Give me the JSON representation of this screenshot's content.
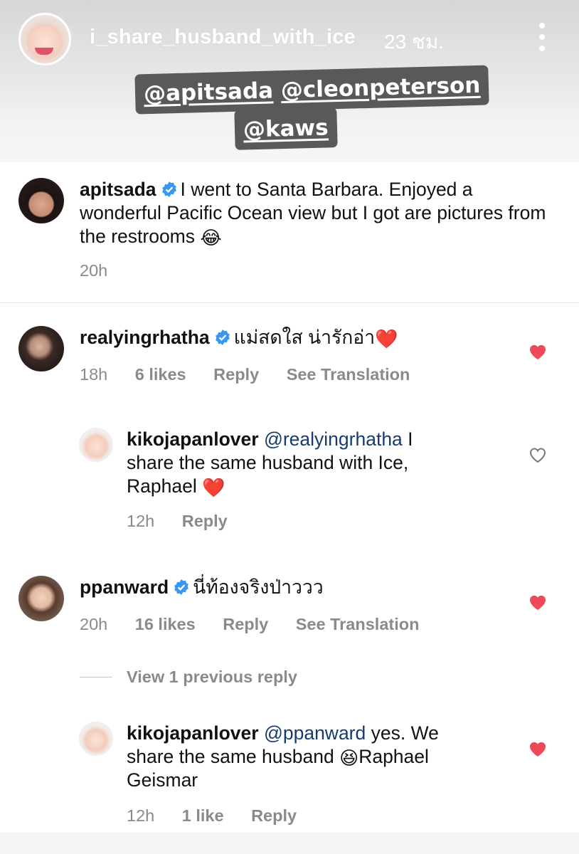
{
  "story": {
    "username": "i_share_husband_with_ice",
    "time": "23 ชม.",
    "tags": [
      "@apitsada",
      "@cleonpeterson",
      "@kaws"
    ]
  },
  "comments": [
    {
      "username": "apitsada",
      "text": "I went to Santa Barbara. Enjoyed a wonderful Pacific Ocean view but I got are pictures from the restrooms",
      "emoji": "😂",
      "time": "20h"
    },
    {
      "username": "realyingrhatha",
      "text": "แม่สดใส น่ารักอ่า",
      "emoji": "❤️",
      "time": "18h",
      "likes": "6 likes",
      "reply": "Reply",
      "translate": "See Translation",
      "liked": true,
      "replies": [
        {
          "username": "kikojapanlover",
          "mention": "@realyingrhatha",
          "text_1": "I",
          "text_2": "share the same husband with Ice,",
          "text_3": "Raphael",
          "emoji": "❤️",
          "time": "12h",
          "reply": "Reply",
          "liked": false
        }
      ]
    },
    {
      "username": "ppanward",
      "text": "นี่ท้องจริงป่าววว",
      "time": "20h",
      "likes": "16 likes",
      "reply": "Reply",
      "translate": "See Translation",
      "liked": true,
      "view_replies": "View 1 previous reply",
      "replies": [
        {
          "username": "kikojapanlover",
          "mention": "@ppanward",
          "text_1": "yes. We",
          "text_2": "share the same husband",
          "emoji": "😆",
          "text_3": "Raphael",
          "text_4": "Geismar",
          "time": "12h",
          "likes": "1 like",
          "reply": "Reply",
          "liked": true
        }
      ]
    }
  ],
  "colors": {
    "heart_red": "#ed4956",
    "mention_blue": "#183b6e",
    "meta_gray": "#8a8a8a",
    "verified_blue": "#3897f0"
  }
}
